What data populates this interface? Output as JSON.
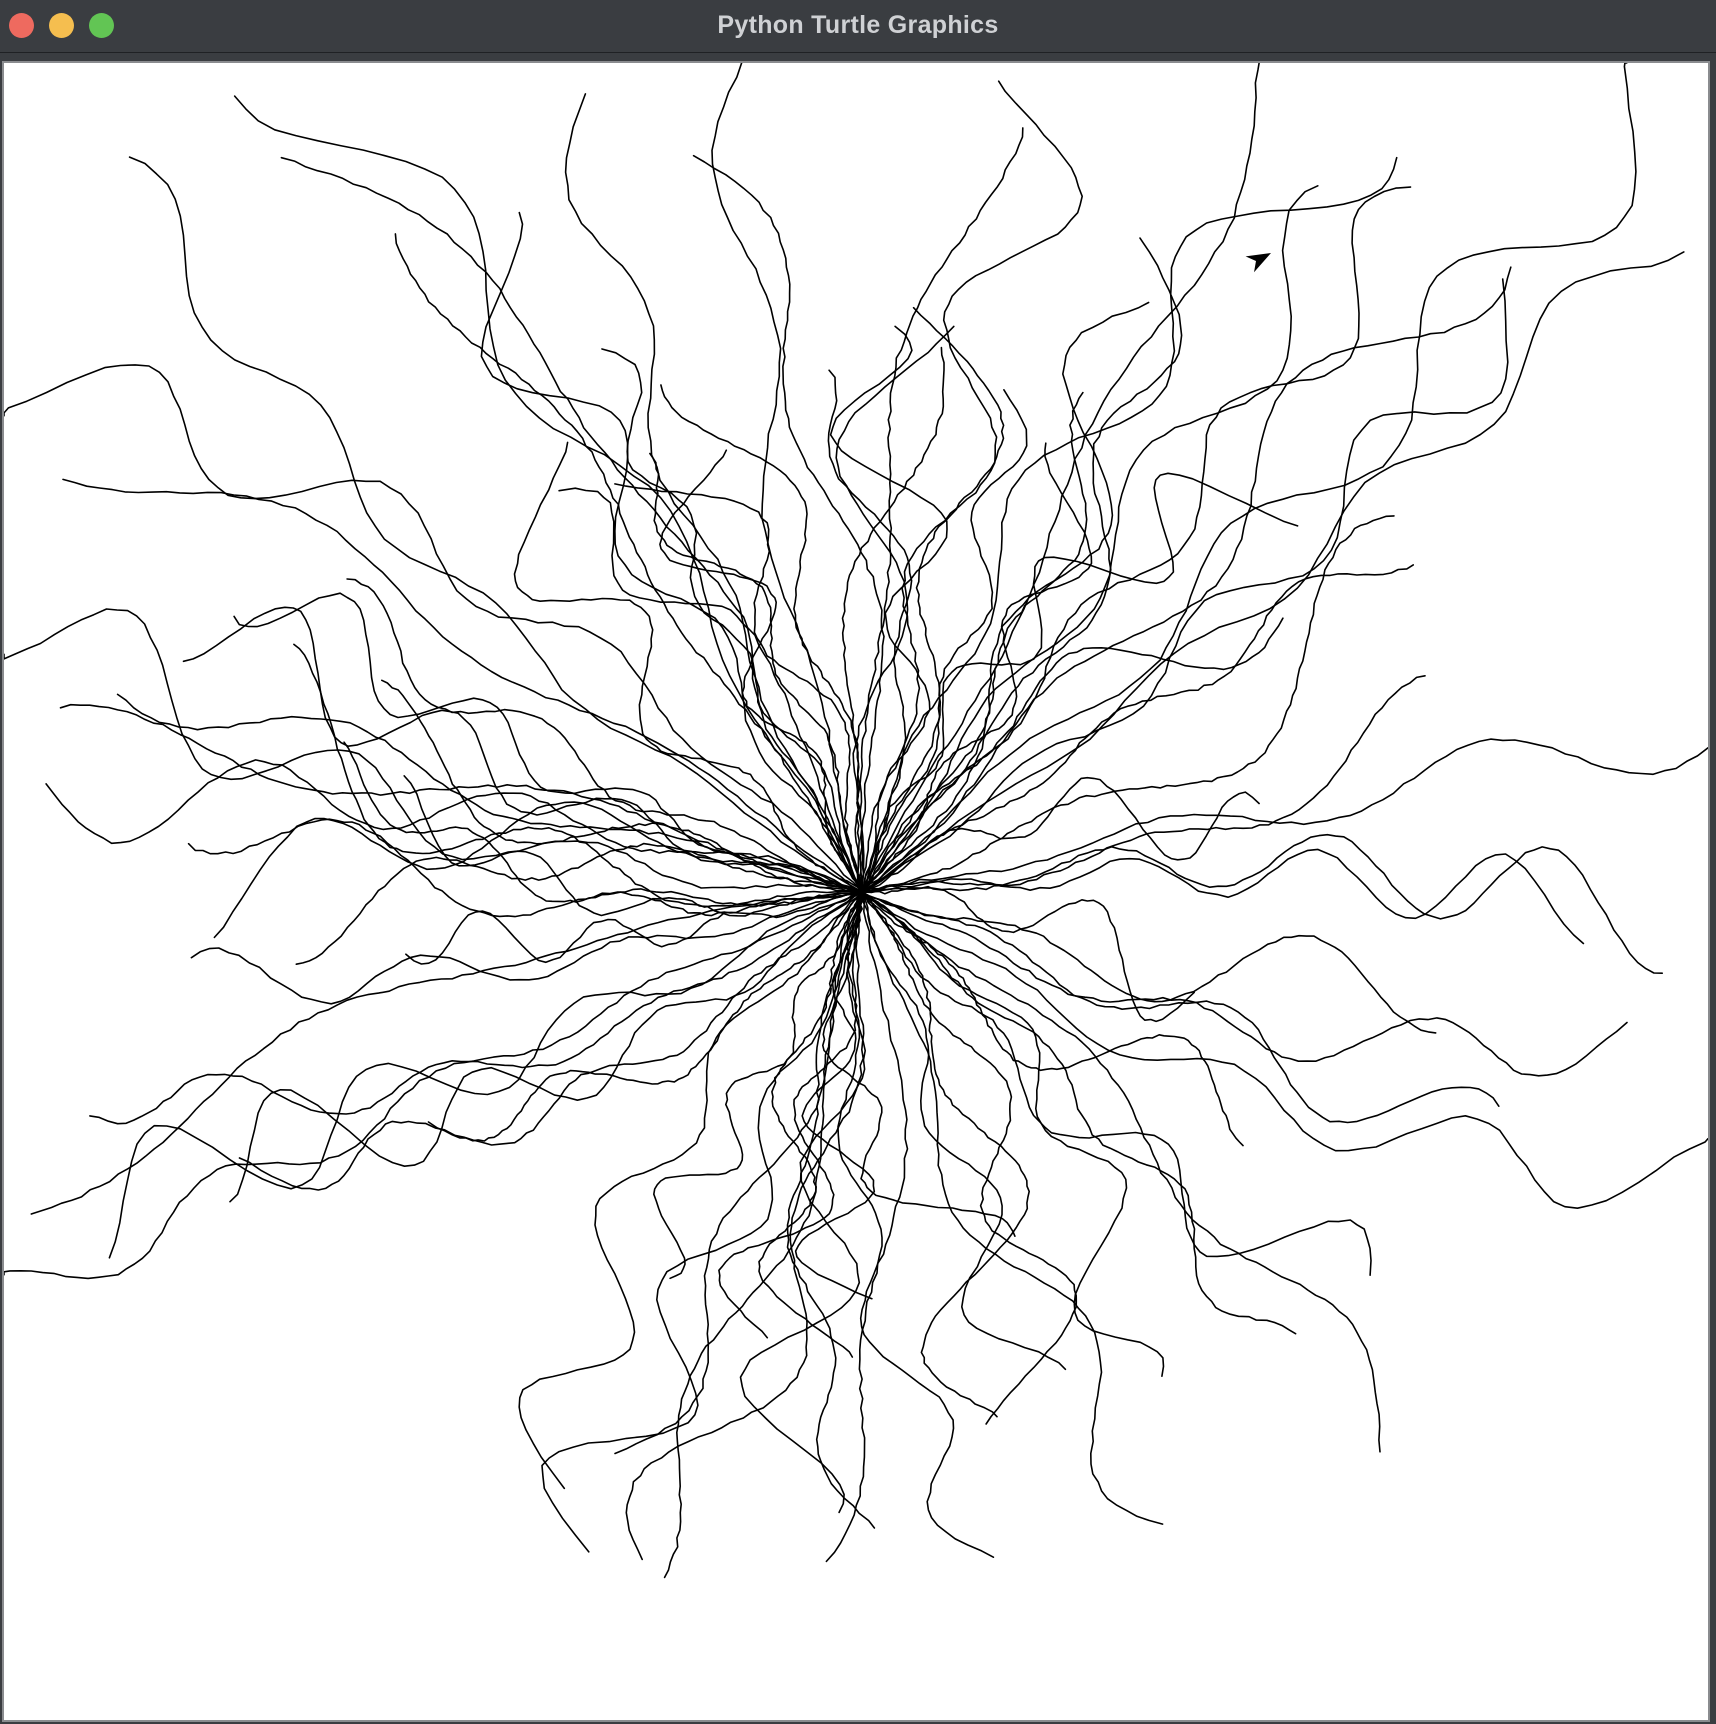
{
  "window": {
    "title": "Python Turtle Graphics",
    "controls": {
      "close_color": "#ee6a5f",
      "minimize_color": "#f5be4f",
      "zoom_color": "#62c554"
    }
  },
  "canvas": {
    "background": "#ffffff",
    "stroke_color": "#000000",
    "drawing": "random-walk burst of lines radiating from a common center",
    "turtle_cursor": "arrow",
    "turtle_cursor_color": "#000000"
  }
}
